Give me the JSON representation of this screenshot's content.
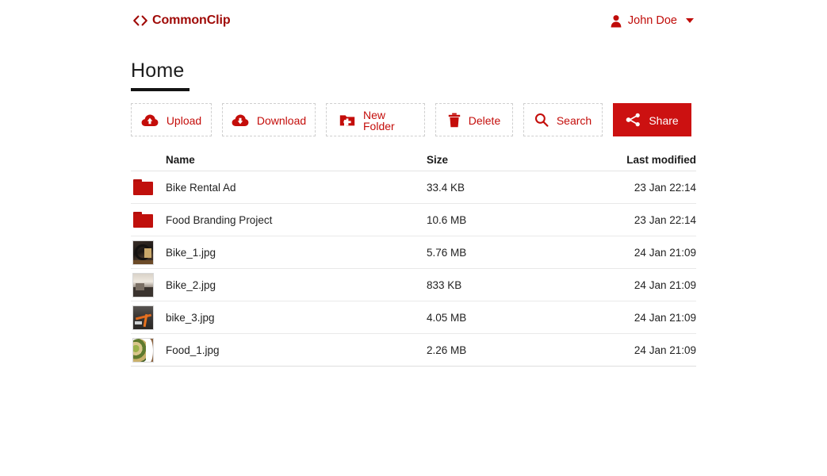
{
  "header": {
    "brand_mark": "‹›",
    "brand_name": "CommonClip",
    "user_name": "John Doe",
    "user_icon": "person-icon",
    "caret_icon": "chevron-down-icon"
  },
  "page": {
    "title": "Home"
  },
  "toolbar": {
    "buttons": [
      {
        "label": "Upload",
        "icon": "cloud-upload-icon",
        "style": "dashed"
      },
      {
        "label": "Download",
        "icon": "cloud-download-icon",
        "style": "dashed"
      },
      {
        "label": "New Folder",
        "icon": "folder-plus-icon",
        "style": "dashed"
      },
      {
        "label": "Delete",
        "icon": "trash-icon",
        "style": "dashed"
      },
      {
        "label": "Search",
        "icon": "search-icon",
        "style": "dashed"
      },
      {
        "label": "Share",
        "icon": "share-nodes-icon",
        "style": "filled"
      }
    ]
  },
  "table": {
    "columns": [
      "Name",
      "Size",
      "Last modified"
    ],
    "rows": [
      {
        "name": "Bike Rental Ad",
        "size": "33.4 KB",
        "modified": "23 Jan 22:14",
        "icon": "folder-icon",
        "kind": "folder"
      },
      {
        "name": "Food Branding Project",
        "size": "10.6 MB",
        "modified": "23 Jan 22:14",
        "icon": "folder-icon",
        "kind": "folder"
      },
      {
        "name": "Bike_1.jpg",
        "size": "5.76 MB",
        "modified": "24 Jan 21:09",
        "icon": "image-thumbnail",
        "kind": "image"
      },
      {
        "name": "Bike_2.jpg",
        "size": "833 KB",
        "modified": "24 Jan 21:09",
        "icon": "image-thumbnail",
        "kind": "image"
      },
      {
        "name": "bike_3.jpg",
        "size": "4.05 MB",
        "modified": "24 Jan 21:09",
        "icon": "image-thumbnail",
        "kind": "image"
      },
      {
        "name": "Food_1.jpg",
        "size": "2.26 MB",
        "modified": "24 Jan 21:09",
        "icon": "image-thumbnail",
        "kind": "image"
      }
    ]
  },
  "colors": {
    "brand_red": "#a00b08",
    "accent_red": "#c40d0a",
    "share_red": "#cc1111",
    "folder_red": "#c0100c",
    "text_dark": "#1b1b1b",
    "border_dashed": "#cfcfcf",
    "row_border": "#e9e9e9",
    "background": "#ffffff"
  }
}
